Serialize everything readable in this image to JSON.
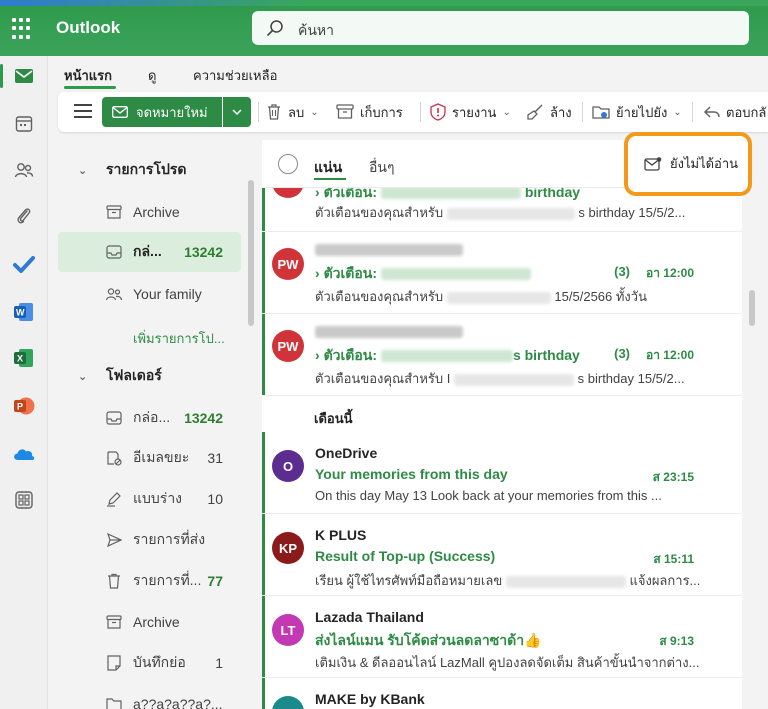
{
  "app": {
    "name": "Outlook"
  },
  "search": {
    "placeholder": "ค้นหา"
  },
  "tabs": [
    {
      "label": "หน้าแรก"
    },
    {
      "label": "ดู"
    },
    {
      "label": "ความช่วยเหลือ"
    }
  ],
  "toolbar": {
    "new_mail": "จดหมายใหม่",
    "delete": "ลบ",
    "archive": "เก็บการ",
    "report": "รายงาน",
    "sweep": "ล้าง",
    "move_to": "ย้ายไปยัง",
    "reply_all": "ตอบกลั"
  },
  "folders": {
    "favorites_header": "รายการโปรด",
    "favorites": [
      {
        "label": "Archive",
        "count": ""
      },
      {
        "label": "กล่...",
        "count": "13242"
      },
      {
        "label": "Your family",
        "count": ""
      }
    ],
    "add_favorite": "เพิ่มรายการโป...",
    "folders_header": "โฟลเดอร์",
    "list": [
      {
        "label": "กล่อ...",
        "count": "13242"
      },
      {
        "label": "อีเมลขยะ",
        "count": "31"
      },
      {
        "label": "แบบร่าง",
        "count": "10"
      },
      {
        "label": "รายการที่ส่ง",
        "count": ""
      },
      {
        "label": "รายการที่...",
        "count": "77"
      },
      {
        "label": "Archive",
        "count": ""
      },
      {
        "label": "บันทึกย่อ",
        "count": "1"
      },
      {
        "label": "a??a?a??a?...",
        "count": ""
      }
    ]
  },
  "list_header": {
    "focused": "แน่น",
    "other": "อื่นๆ",
    "unread_filter": "ยังไม่ได้อ่าน"
  },
  "messages_top": [
    {
      "subject_prefix": "ตัวเตือน:",
      "subject_suffix": "birthday",
      "preview_start": "ตัวเตือนของคุณสำหรับ",
      "preview_end": "s birthday 15/5/2..."
    },
    {
      "initials": "PW",
      "subject_prefix": "ตัวเตือน:",
      "count": "(3)",
      "time": "อา 12:00",
      "preview_start": "ตัวเตือนของคุณสำหรับ",
      "preview_end": "15/5/2566 ทั้งวัน"
    },
    {
      "initials": "PW",
      "subject_prefix": "ตัวเตือน:",
      "subject_suffix": "s birthday",
      "count": "(3)",
      "time": "อา 12:00",
      "preview_start": "ตัวเตือนของคุณสำหรับ I",
      "preview_end": "s birthday 15/5/2..."
    }
  ],
  "section_label": "เดือนนี้",
  "messages": [
    {
      "initials": "O",
      "sender": "OneDrive",
      "subject": "Your memories from this day",
      "time": "ส 23:15",
      "preview": "On this day May 13 Look back at your memories from this ...",
      "color": "#5c2d91"
    },
    {
      "initials": "KP",
      "sender": "K PLUS",
      "subject": "Result of Top-up (Success)",
      "time": "ส 15:11",
      "preview_start": "เรียน ผู้ใช้ไทรศัพท์มือถือหมายเลข",
      "preview_end": "แจ้งผลการ...",
      "color": "#8b1a1a"
    },
    {
      "initials": "LT",
      "sender": "Lazada Thailand",
      "subject": "ส่งไลน์แมน รับโค้ดส่วนลดลาซาด้า👍",
      "time": "ส 9:13",
      "preview": "เติมเงิน & ดีลออนไลน์ LazMall คูปองลดจัดเต็ม สินค้าขั้นนำจากต่าง...",
      "color": "#c239b3"
    },
    {
      "sender": "MAKE by KBank",
      "color": "#1a8a8a"
    }
  ],
  "colors": {
    "brand": "#2e9a4b",
    "accent": "#2e8b45",
    "highlight": "#f39a1a",
    "pw_avatar": "#d13438"
  }
}
